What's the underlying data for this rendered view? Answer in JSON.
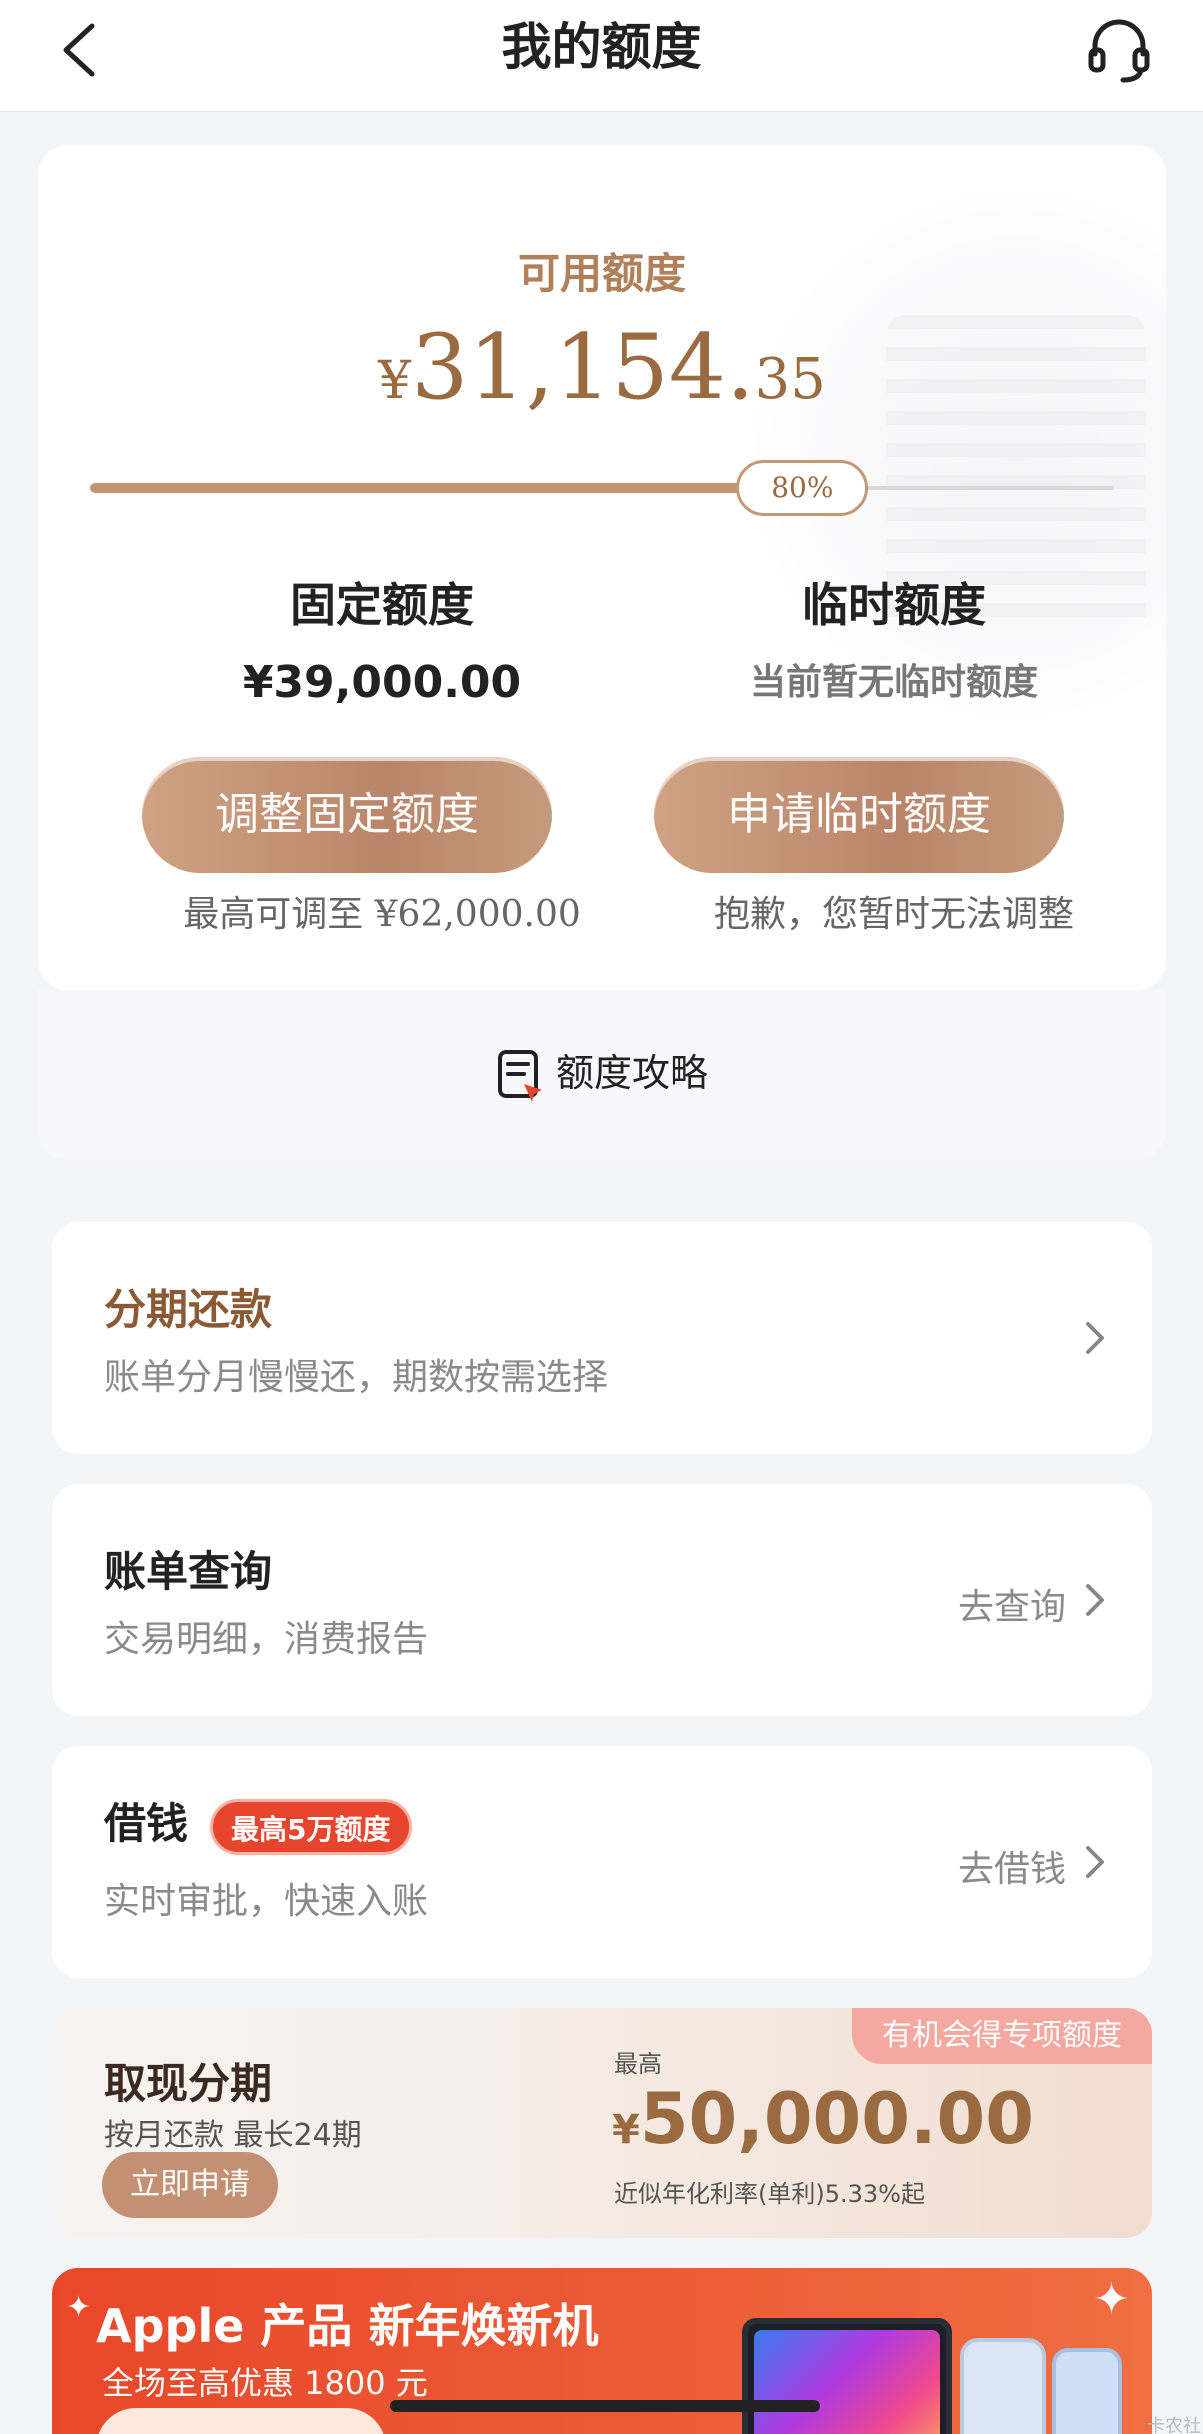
{
  "nav": {
    "title": "我的额度"
  },
  "credit": {
    "available_label": "可用额度",
    "available_currency": "¥",
    "available_integer": "31,154.",
    "available_decimal": "35",
    "usage_percent_label": "80%",
    "usage_fraction": 0.8,
    "fixed": {
      "title": "固定额度",
      "value": "¥39,000.00",
      "button": "调整固定额度",
      "note": "最高可调至 ¥62,000.00"
    },
    "temporary": {
      "title": "临时额度",
      "value": "当前暂无临时额度",
      "button": "申请临时额度",
      "note": "抱歉，您暂时无法调整"
    },
    "strategy_label": "额度攻略"
  },
  "menu": {
    "installment": {
      "title": "分期还款",
      "subtitle": "账单分月慢慢还，期数按需选择"
    },
    "bill": {
      "title": "账单查询",
      "subtitle": "交易明细，消费报告",
      "action": "去查询"
    },
    "borrow": {
      "title": "借钱",
      "badge": "最高5万额度",
      "subtitle": "实时审批，快速入账",
      "action": "去借钱"
    }
  },
  "cash_installment": {
    "title": "取现分期",
    "subtitle": "按月还款 最长24期",
    "apply_button": "立即申请",
    "tag": "有机会得专项额度",
    "max_label": "最高",
    "currency": "¥",
    "amount": "50,000.00",
    "rate": "近似年化利率(单利)5.33%起"
  },
  "apple_banner": {
    "title": "Apple 产品 新年焕新机",
    "subtitle": "全场至高优惠 1800 元"
  },
  "corner_text": "卡农社"
}
